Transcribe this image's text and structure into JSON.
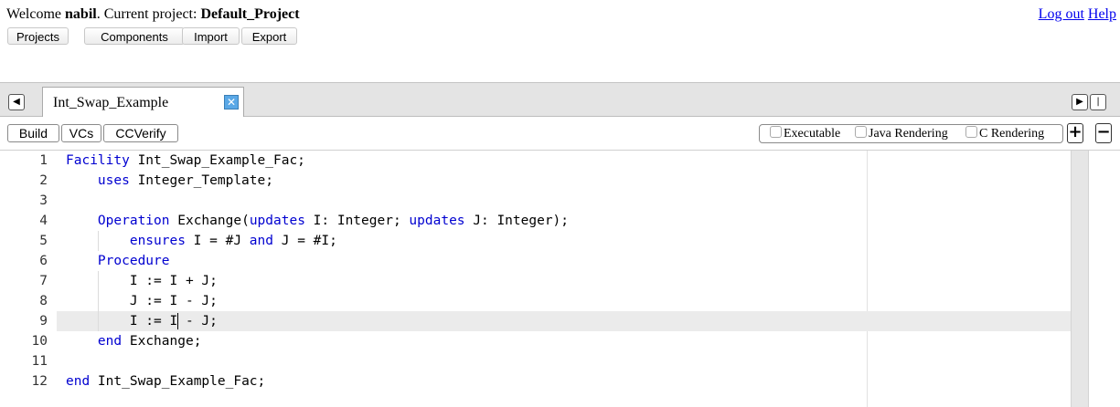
{
  "header": {
    "welcome_prefix": "Welcome ",
    "username": "nabil",
    "project_prefix": ". Current project: ",
    "project_name": "Default_Project",
    "logout_label": "Log out",
    "help_label": "Help"
  },
  "nav": {
    "projects": "Projects",
    "components": "Components",
    "import": "Import",
    "export": "Export"
  },
  "tabs": {
    "prev_icon": "◀",
    "next_icon": "▶",
    "end_icon": "|",
    "active_tab": "Int_Swap_Example",
    "close_icon": "✕"
  },
  "toolbar": {
    "build": "Build",
    "vcs": "VCs",
    "ccverify": "CCVerify",
    "options": [
      "Executable",
      "Java Rendering",
      "C Rendering"
    ],
    "plus": "+",
    "minus": "−"
  },
  "editor": {
    "line_numbers": [
      "1",
      "2",
      "3",
      "4",
      "5",
      "6",
      "7",
      "8",
      "9",
      "10",
      "11",
      "12"
    ],
    "active_line": 9,
    "lines": [
      [
        {
          "t": "Facility",
          "k": true
        },
        {
          "t": " Int_Swap_Example_Fac;"
        }
      ],
      [
        {
          "t": "    "
        },
        {
          "t": "uses",
          "k": true
        },
        {
          "t": " Integer_Template;"
        }
      ],
      [
        {
          "t": ""
        }
      ],
      [
        {
          "t": "    "
        },
        {
          "t": "Operation",
          "k": true
        },
        {
          "t": " Exchange("
        },
        {
          "t": "updates",
          "k": true
        },
        {
          "t": " I: Integer; "
        },
        {
          "t": "updates",
          "k": true
        },
        {
          "t": " J: Integer);"
        }
      ],
      [
        {
          "t": "        "
        },
        {
          "t": "ensures",
          "k": true
        },
        {
          "t": " I = #J "
        },
        {
          "t": "and",
          "k": true
        },
        {
          "t": " J = #I;"
        }
      ],
      [
        {
          "t": "    "
        },
        {
          "t": "Procedure",
          "k": true
        }
      ],
      [
        {
          "t": "        I := I + J;"
        }
      ],
      [
        {
          "t": "        J := I - J;"
        }
      ],
      [
        {
          "t": "        I := I - J;"
        }
      ],
      [
        {
          "t": "    "
        },
        {
          "t": "end",
          "k": true
        },
        {
          "t": " Exchange;"
        }
      ],
      [
        {
          "t": ""
        }
      ],
      [
        {
          "t": "end",
          "k": true
        },
        {
          "t": " Int_Swap_Example_Fac;"
        }
      ]
    ]
  },
  "colors": {
    "keyword": "#0000d0",
    "link": "#0000ee",
    "active_line_bg": "#ebebeb"
  }
}
